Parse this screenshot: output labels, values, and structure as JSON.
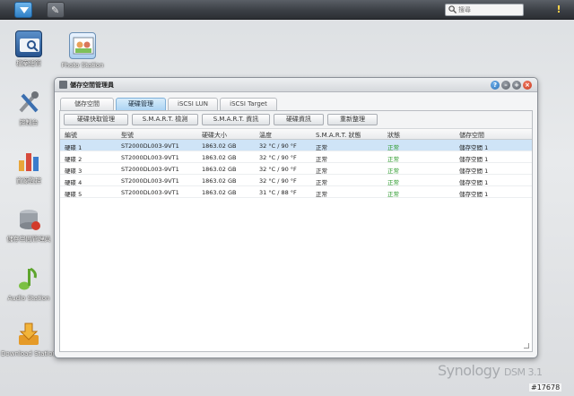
{
  "taskbar": {
    "search_placeholder": "搜尋",
    "main_menu_icon": "chevron-down-icon",
    "app_icon": "notepad-icon",
    "notification_icon": "exclamation-icon"
  },
  "desktop": {
    "icons": [
      {
        "label": "檔案總管",
        "icon": "folder-search-icon"
      },
      {
        "label": "Photo Station",
        "icon": "photo-icon"
      },
      {
        "label": "控制台",
        "icon": "tools-icon"
      },
      {
        "label": "資源監控",
        "icon": "bar-chart-icon"
      },
      {
        "label": "儲存空間管理員",
        "icon": "storage-disk-icon"
      },
      {
        "label": "Audio Station",
        "icon": "music-note-icon"
      },
      {
        "label": "Download Station",
        "icon": "download-arrow-icon"
      }
    ]
  },
  "window": {
    "title": "儲存空間管理員",
    "tabs": [
      {
        "label": "儲存空間",
        "active": false
      },
      {
        "label": "硬碟管理",
        "active": true
      },
      {
        "label": "iSCSI LUN",
        "active": false
      },
      {
        "label": "iSCSI Target",
        "active": false
      }
    ],
    "toolbar": {
      "buttons": [
        "硬碟快取管理",
        "S.M.A.R.T. 檢測",
        "S.M.A.R.T. 資訊",
        "硬碟資訊",
        "重新整理"
      ]
    },
    "table": {
      "headers": [
        "編號",
        "型號",
        "硬碟大小",
        "溫度",
        "S.M.A.R.T. 狀態",
        "狀態",
        "儲存空間"
      ],
      "rows": [
        [
          "硬碟 1",
          "ST2000DL003-9VT1",
          "1863.02 GB",
          "32 °C / 90 °F",
          "正常",
          "正常",
          "儲存空間 1"
        ],
        [
          "硬碟 2",
          "ST2000DL003-9VT1",
          "1863.02 GB",
          "32 °C / 90 °F",
          "正常",
          "正常",
          "儲存空間 1"
        ],
        [
          "硬碟 3",
          "ST2000DL003-9VT1",
          "1863.02 GB",
          "32 °C / 90 °F",
          "正常",
          "正常",
          "儲存空間 1"
        ],
        [
          "硬碟 4",
          "ST2000DL003-9VT1",
          "1863.02 GB",
          "32 °C / 90 °F",
          "正常",
          "正常",
          "儲存空間 1"
        ],
        [
          "硬碟 5",
          "ST2000DL003-9VT1",
          "1863.02 GB",
          "31 °C / 88 °F",
          "正常",
          "正常",
          "儲存空間 1"
        ]
      ],
      "selected_row": 0
    }
  },
  "brand": {
    "name": "Synology",
    "version": "DSM 3.1"
  },
  "watermark": "#17678",
  "colors": {
    "accent": "#2f7fc5",
    "status_ok": "#2b9a2b",
    "selected_row": "#cfe4f7"
  }
}
